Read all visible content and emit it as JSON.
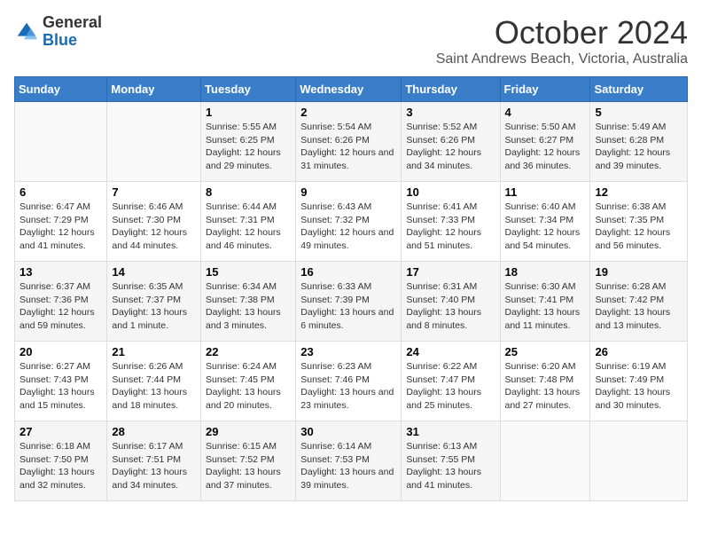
{
  "header": {
    "logo_general": "General",
    "logo_blue": "Blue",
    "month_title": "October 2024",
    "subtitle": "Saint Andrews Beach, Victoria, Australia"
  },
  "days_of_week": [
    "Sunday",
    "Monday",
    "Tuesday",
    "Wednesday",
    "Thursday",
    "Friday",
    "Saturday"
  ],
  "weeks": [
    [
      {
        "day": "",
        "sunrise": "",
        "sunset": "",
        "daylight": ""
      },
      {
        "day": "",
        "sunrise": "",
        "sunset": "",
        "daylight": ""
      },
      {
        "day": "1",
        "sunrise": "Sunrise: 5:55 AM",
        "sunset": "Sunset: 6:25 PM",
        "daylight": "Daylight: 12 hours and 29 minutes."
      },
      {
        "day": "2",
        "sunrise": "Sunrise: 5:54 AM",
        "sunset": "Sunset: 6:26 PM",
        "daylight": "Daylight: 12 hours and 31 minutes."
      },
      {
        "day": "3",
        "sunrise": "Sunrise: 5:52 AM",
        "sunset": "Sunset: 6:26 PM",
        "daylight": "Daylight: 12 hours and 34 minutes."
      },
      {
        "day": "4",
        "sunrise": "Sunrise: 5:50 AM",
        "sunset": "Sunset: 6:27 PM",
        "daylight": "Daylight: 12 hours and 36 minutes."
      },
      {
        "day": "5",
        "sunrise": "Sunrise: 5:49 AM",
        "sunset": "Sunset: 6:28 PM",
        "daylight": "Daylight: 12 hours and 39 minutes."
      }
    ],
    [
      {
        "day": "6",
        "sunrise": "Sunrise: 6:47 AM",
        "sunset": "Sunset: 7:29 PM",
        "daylight": "Daylight: 12 hours and 41 minutes."
      },
      {
        "day": "7",
        "sunrise": "Sunrise: 6:46 AM",
        "sunset": "Sunset: 7:30 PM",
        "daylight": "Daylight: 12 hours and 44 minutes."
      },
      {
        "day": "8",
        "sunrise": "Sunrise: 6:44 AM",
        "sunset": "Sunset: 7:31 PM",
        "daylight": "Daylight: 12 hours and 46 minutes."
      },
      {
        "day": "9",
        "sunrise": "Sunrise: 6:43 AM",
        "sunset": "Sunset: 7:32 PM",
        "daylight": "Daylight: 12 hours and 49 minutes."
      },
      {
        "day": "10",
        "sunrise": "Sunrise: 6:41 AM",
        "sunset": "Sunset: 7:33 PM",
        "daylight": "Daylight: 12 hours and 51 minutes."
      },
      {
        "day": "11",
        "sunrise": "Sunrise: 6:40 AM",
        "sunset": "Sunset: 7:34 PM",
        "daylight": "Daylight: 12 hours and 54 minutes."
      },
      {
        "day": "12",
        "sunrise": "Sunrise: 6:38 AM",
        "sunset": "Sunset: 7:35 PM",
        "daylight": "Daylight: 12 hours and 56 minutes."
      }
    ],
    [
      {
        "day": "13",
        "sunrise": "Sunrise: 6:37 AM",
        "sunset": "Sunset: 7:36 PM",
        "daylight": "Daylight: 12 hours and 59 minutes."
      },
      {
        "day": "14",
        "sunrise": "Sunrise: 6:35 AM",
        "sunset": "Sunset: 7:37 PM",
        "daylight": "Daylight: 13 hours and 1 minute."
      },
      {
        "day": "15",
        "sunrise": "Sunrise: 6:34 AM",
        "sunset": "Sunset: 7:38 PM",
        "daylight": "Daylight: 13 hours and 3 minutes."
      },
      {
        "day": "16",
        "sunrise": "Sunrise: 6:33 AM",
        "sunset": "Sunset: 7:39 PM",
        "daylight": "Daylight: 13 hours and 6 minutes."
      },
      {
        "day": "17",
        "sunrise": "Sunrise: 6:31 AM",
        "sunset": "Sunset: 7:40 PM",
        "daylight": "Daylight: 13 hours and 8 minutes."
      },
      {
        "day": "18",
        "sunrise": "Sunrise: 6:30 AM",
        "sunset": "Sunset: 7:41 PM",
        "daylight": "Daylight: 13 hours and 11 minutes."
      },
      {
        "day": "19",
        "sunrise": "Sunrise: 6:28 AM",
        "sunset": "Sunset: 7:42 PM",
        "daylight": "Daylight: 13 hours and 13 minutes."
      }
    ],
    [
      {
        "day": "20",
        "sunrise": "Sunrise: 6:27 AM",
        "sunset": "Sunset: 7:43 PM",
        "daylight": "Daylight: 13 hours and 15 minutes."
      },
      {
        "day": "21",
        "sunrise": "Sunrise: 6:26 AM",
        "sunset": "Sunset: 7:44 PM",
        "daylight": "Daylight: 13 hours and 18 minutes."
      },
      {
        "day": "22",
        "sunrise": "Sunrise: 6:24 AM",
        "sunset": "Sunset: 7:45 PM",
        "daylight": "Daylight: 13 hours and 20 minutes."
      },
      {
        "day": "23",
        "sunrise": "Sunrise: 6:23 AM",
        "sunset": "Sunset: 7:46 PM",
        "daylight": "Daylight: 13 hours and 23 minutes."
      },
      {
        "day": "24",
        "sunrise": "Sunrise: 6:22 AM",
        "sunset": "Sunset: 7:47 PM",
        "daylight": "Daylight: 13 hours and 25 minutes."
      },
      {
        "day": "25",
        "sunrise": "Sunrise: 6:20 AM",
        "sunset": "Sunset: 7:48 PM",
        "daylight": "Daylight: 13 hours and 27 minutes."
      },
      {
        "day": "26",
        "sunrise": "Sunrise: 6:19 AM",
        "sunset": "Sunset: 7:49 PM",
        "daylight": "Daylight: 13 hours and 30 minutes."
      }
    ],
    [
      {
        "day": "27",
        "sunrise": "Sunrise: 6:18 AM",
        "sunset": "Sunset: 7:50 PM",
        "daylight": "Daylight: 13 hours and 32 minutes."
      },
      {
        "day": "28",
        "sunrise": "Sunrise: 6:17 AM",
        "sunset": "Sunset: 7:51 PM",
        "daylight": "Daylight: 13 hours and 34 minutes."
      },
      {
        "day": "29",
        "sunrise": "Sunrise: 6:15 AM",
        "sunset": "Sunset: 7:52 PM",
        "daylight": "Daylight: 13 hours and 37 minutes."
      },
      {
        "day": "30",
        "sunrise": "Sunrise: 6:14 AM",
        "sunset": "Sunset: 7:53 PM",
        "daylight": "Daylight: 13 hours and 39 minutes."
      },
      {
        "day": "31",
        "sunrise": "Sunrise: 6:13 AM",
        "sunset": "Sunset: 7:55 PM",
        "daylight": "Daylight: 13 hours and 41 minutes."
      },
      {
        "day": "",
        "sunrise": "",
        "sunset": "",
        "daylight": ""
      },
      {
        "day": "",
        "sunrise": "",
        "sunset": "",
        "daylight": ""
      }
    ]
  ]
}
